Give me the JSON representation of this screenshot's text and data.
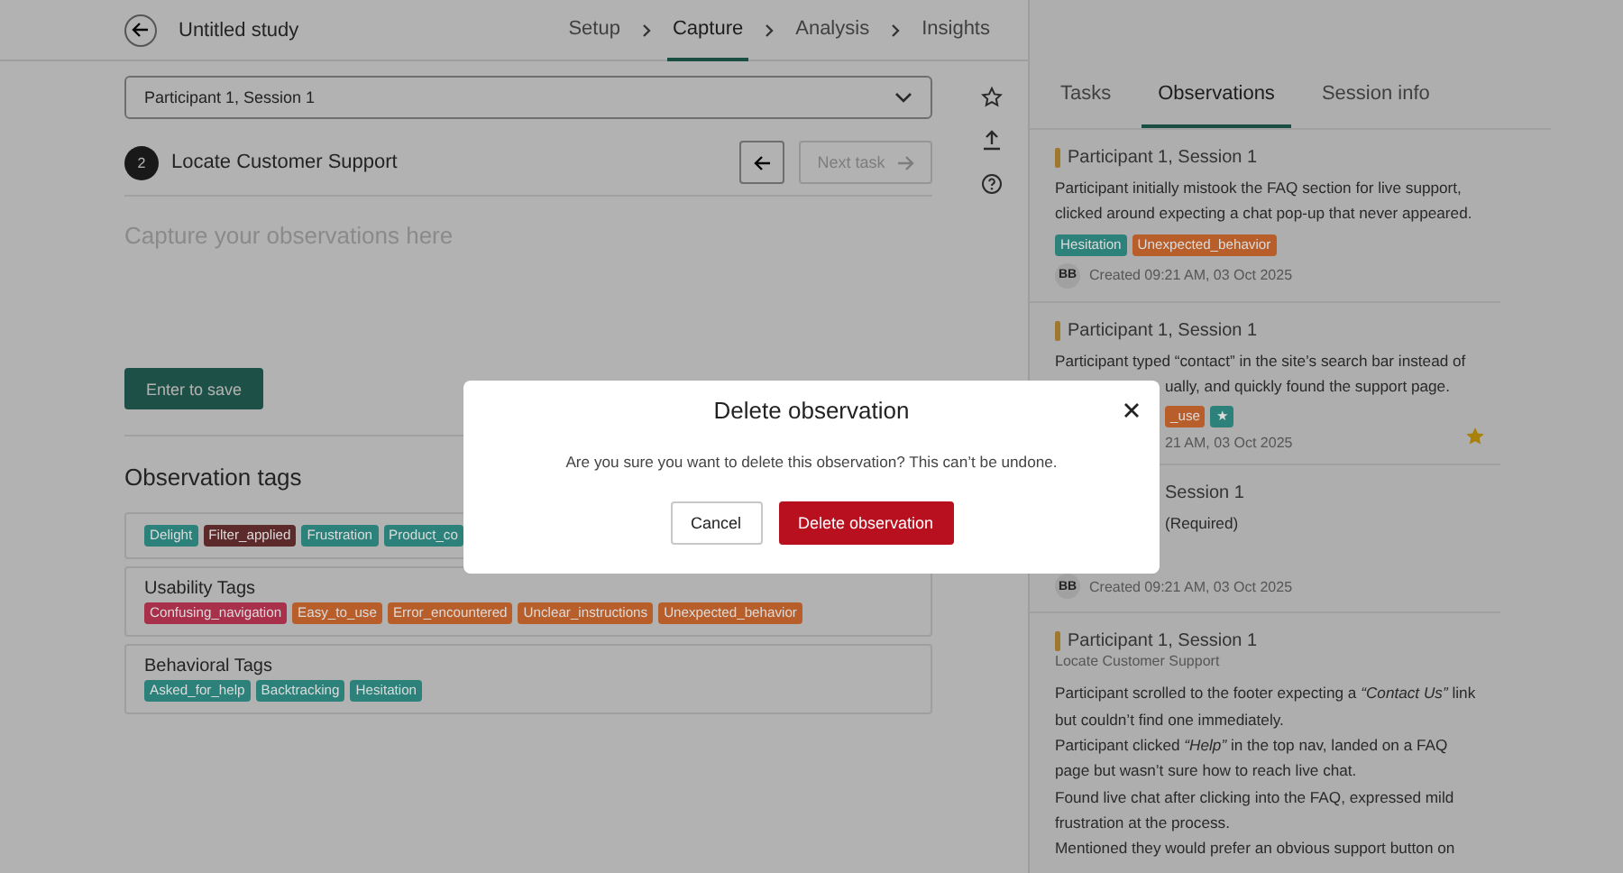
{
  "header": {
    "title": "Untitled study",
    "steps": [
      {
        "label": "Setup",
        "selected": false
      },
      {
        "label": "Capture",
        "selected": true
      },
      {
        "label": "Analysis",
        "selected": false
      },
      {
        "label": "Insights",
        "selected": false
      }
    ]
  },
  "session_select": {
    "value": "Participant 1, Session 1"
  },
  "task": {
    "number": "2",
    "title": "Locate Customer Support",
    "next_label": "Next task",
    "next_disabled": true
  },
  "notes": {
    "placeholder": "Capture your observations here"
  },
  "save_button": "Enter to save",
  "tags_section": {
    "title": "Observation tags",
    "groups": [
      {
        "tags": [
          {
            "label": "Delight",
            "color": "#2c827b"
          },
          {
            "label": "Filter_applied",
            "color": "#5c2a2b"
          },
          {
            "label": "Frustration",
            "color": "#2c827b"
          },
          {
            "label": "Product_co",
            "color": "#2c827b"
          }
        ]
      },
      {
        "title": "Usability Tags",
        "tags": [
          {
            "label": "Confusing_navigation",
            "color": "#a8304a"
          },
          {
            "label": "Easy_to_use",
            "color": "#b85e2a"
          },
          {
            "label": "Error_encountered",
            "color": "#b85e2a"
          },
          {
            "label": "Unclear_instructions",
            "color": "#b85e2a"
          },
          {
            "label": "Unexpected_behavior",
            "color": "#b85e2a"
          }
        ]
      },
      {
        "title": "Behavioral Tags",
        "tags": [
          {
            "label": "Asked_for_help",
            "color": "#2c827b"
          },
          {
            "label": "Backtracking",
            "color": "#2c827b"
          },
          {
            "label": "Hesitation",
            "color": "#2c827b"
          }
        ]
      }
    ]
  },
  "panel_tabs": [
    {
      "label": "Tasks",
      "selected": false
    },
    {
      "label": "Observations",
      "selected": true
    },
    {
      "label": "Session info",
      "selected": false
    }
  ],
  "observations": [
    {
      "starred": false,
      "rows": [
        {
          "kind": "header",
          "text": "Participant 1, Session 1",
          "clipped": false
        },
        {
          "kind": "text",
          "text": "Participant initially mistook the FAQ section for live support, clicked around expecting a chat pop-up that never appeared.",
          "clipped": false
        },
        {
          "kind": "tags",
          "clipped": false,
          "tags": [
            {
              "label": "Hesitation",
              "color": "#2c827b"
            },
            {
              "label": "Unexpected_behavior",
              "color": "#b85e2a"
            }
          ]
        },
        {
          "kind": "meta",
          "avatar": "BB",
          "text": "Created 09:21 AM, 03 Oct 2025",
          "clipped": false
        }
      ]
    },
    {
      "starred": true,
      "rows": [
        {
          "kind": "header",
          "text": "Participant 1, Session 1",
          "clipped": false
        },
        {
          "kind": "text",
          "text": "Participant typed “contact” in the site’s search bar instead of",
          "clipped": false
        },
        {
          "kind": "text",
          "text": "ually, and quickly found the support page.",
          "clipped": true
        },
        {
          "kind": "tags",
          "clipped": true,
          "tags": [
            {
              "label": "_use",
              "color": "#b85e2a"
            },
            {
              "label": "★",
              "color": "#2c827b"
            }
          ]
        },
        {
          "kind": "meta",
          "text": "21 AM, 03 Oct 2025",
          "clipped": true
        }
      ]
    },
    {
      "starred": false,
      "rows": [
        {
          "kind": "header",
          "text": "Session 1",
          "clipped": true
        },
        {
          "kind": "text",
          "text": "(Required)",
          "clipped": true
        },
        {
          "kind": "meta",
          "avatar": "BB",
          "text": "Created 09:21 AM, 03 Oct 2025",
          "clipped": false
        }
      ]
    },
    {
      "starred": false,
      "rows": [
        {
          "kind": "header",
          "text": "Participant 1, Session 1",
          "clipped": false
        },
        {
          "kind": "subtitle",
          "text": "Locate Customer Support",
          "clipped": false
        },
        {
          "kind": "text",
          "text": "Participant scrolled to the footer expecting a *“Contact Us”* link but couldn’t find one immediately.",
          "clipped": false
        },
        {
          "kind": "text",
          "text": "Participant clicked *“Help”* in the top nav, landed on a FAQ page but wasn’t sure how to reach live chat.",
          "clipped": false
        },
        {
          "kind": "text",
          "text": "Found live chat after clicking into the FAQ, expressed mild frustration at the process.",
          "clipped": false
        },
        {
          "kind": "text",
          "text": "Mentioned they would prefer an obvious support button on",
          "clipped": false
        }
      ]
    }
  ],
  "dialog": {
    "title": "Delete observation",
    "message": "Are you sure you want to delete this observation? This can’t be undone.",
    "buttons": [
      {
        "label": "Cancel",
        "kind": "secondary"
      },
      {
        "label": "Delete observation",
        "kind": "danger"
      }
    ]
  }
}
